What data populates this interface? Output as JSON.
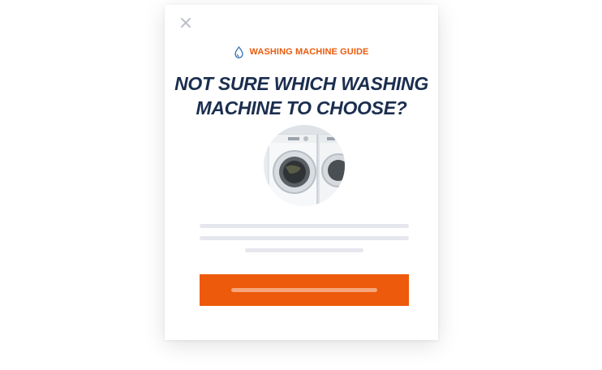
{
  "modal": {
    "close_label": "×",
    "eyebrow": {
      "icon": "water-drop-icon",
      "text": "WASHING MACHINE GUIDE"
    },
    "title_lines": [
      "NOT SURE WHICH WASHING",
      "MACHINE TO CHOOSE?"
    ],
    "image": "washing-machines-photo",
    "colors": {
      "accent": "#ea5b0c",
      "title": "#1b2e4f",
      "icon": "#2f6fb5"
    }
  }
}
